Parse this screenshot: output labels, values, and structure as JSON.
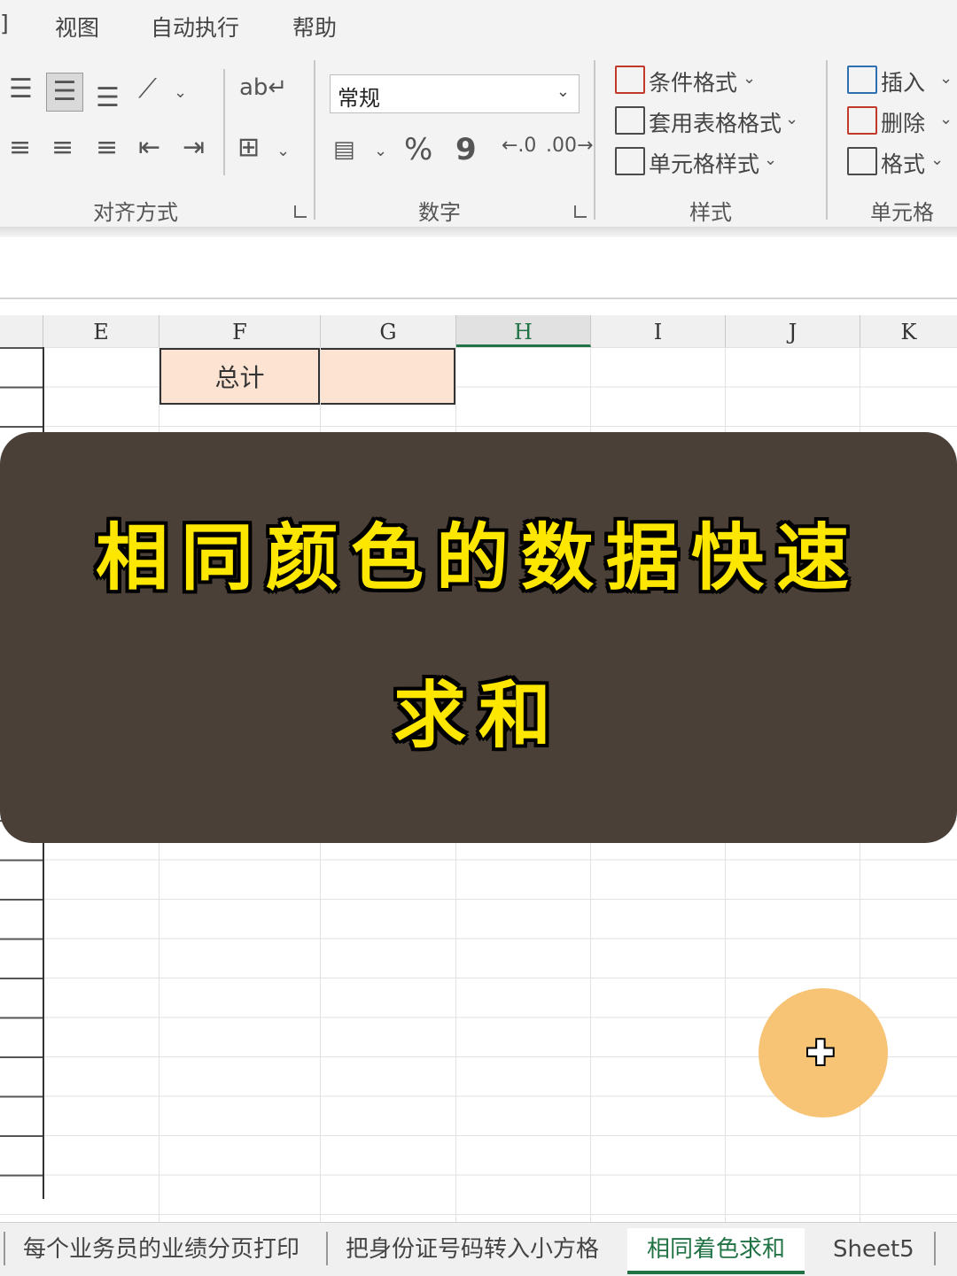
{
  "menu": {
    "partial": "]",
    "items": [
      "视图",
      "自动执行",
      "帮助"
    ]
  },
  "ribbon": {
    "alignment": {
      "label": "对齐方式"
    },
    "number": {
      "label": "数字",
      "format_value": "常规",
      "percent": "%",
      "comma": "9"
    },
    "styles": {
      "label": "样式",
      "conditional_format": "条件格式",
      "table_format": "套用表格格式",
      "cell_styles": "单元格样式"
    },
    "cells": {
      "label": "单元格",
      "insert": "插入",
      "delete": "删除",
      "format": "格式"
    }
  },
  "columns": [
    "E",
    "F",
    "G",
    "H",
    "I",
    "J",
    "K"
  ],
  "selected_column": "H",
  "cells": {
    "F_total": "总计"
  },
  "overlay": {
    "title_line1": "相同颜色的数据快速",
    "title_line2": "求和"
  },
  "sheet_tabs": [
    "每个业务员的业绩分页打印",
    "把身份证号码转入小方格",
    "相同着色求和",
    "Sheet5"
  ],
  "active_tab": "相同着色求和",
  "colors": {
    "accent_green": "#217346",
    "cell_fill": "#fde4d2",
    "overlay_bg": "#4a4037",
    "title_yellow": "#fde700",
    "cursor_halo": "#f6bf6a"
  }
}
